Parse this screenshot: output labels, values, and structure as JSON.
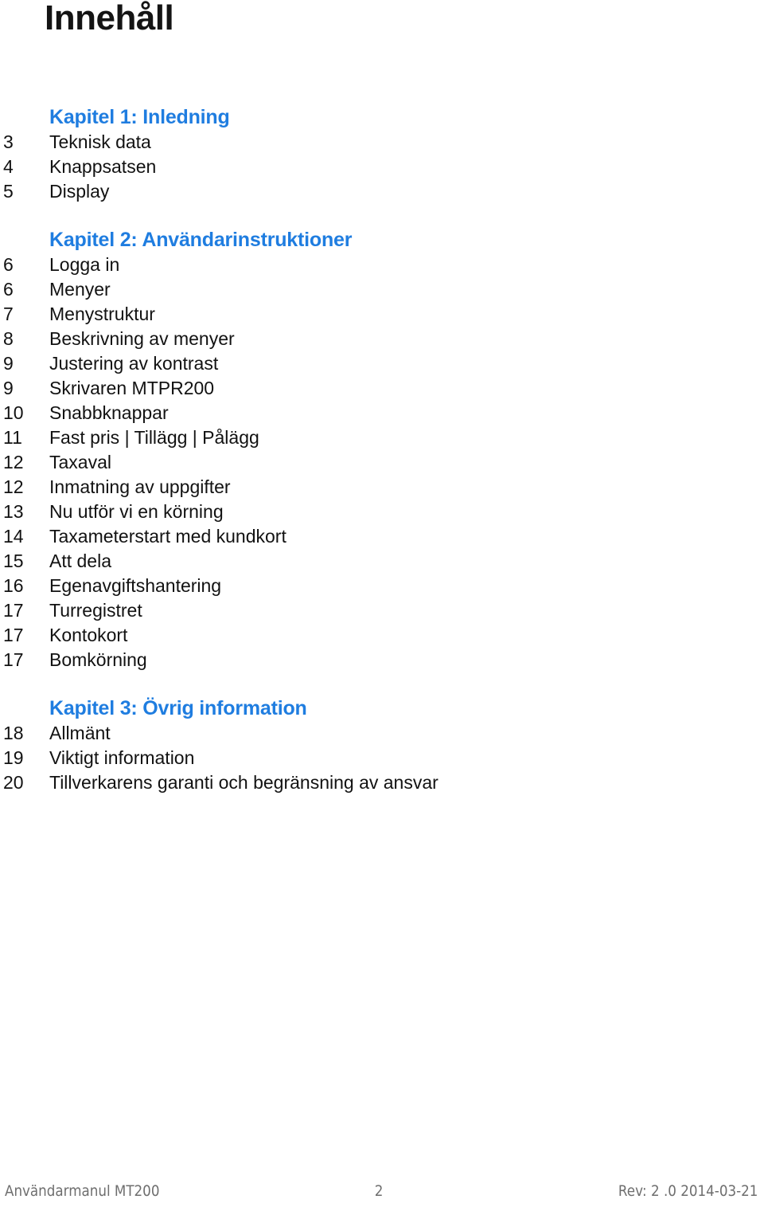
{
  "document": {
    "title": "Innehåll",
    "accent_color": "#1f7de0",
    "text_color": "#121212"
  },
  "toc": {
    "chapters": [
      {
        "heading": "Kapitel 1: Inledning",
        "entries": [
          {
            "page": "3",
            "label": "Teknisk data"
          },
          {
            "page": "4",
            "label": "Knappsatsen"
          },
          {
            "page": "5",
            "label": "Display"
          }
        ]
      },
      {
        "heading": "Kapitel 2: Användarinstruktioner",
        "entries": [
          {
            "page": "6",
            "label": "Logga in"
          },
          {
            "page": "6",
            "label": "Menyer"
          },
          {
            "page": "7",
            "label": "Menystruktur"
          },
          {
            "page": "8",
            "label": "Beskrivning av menyer"
          },
          {
            "page": "9",
            "label": "Justering av kontrast"
          },
          {
            "page": "9",
            "label": "Skrivaren MTPR200"
          },
          {
            "page": "10",
            "label": "Snabbknappar"
          },
          {
            "page": "11",
            "label": "Fast pris | Tillägg | Pålägg"
          },
          {
            "page": "12",
            "label": "Taxaval"
          },
          {
            "page": "12",
            "label": "Inmatning av uppgifter"
          },
          {
            "page": "13",
            "label": "Nu utför vi en körning"
          },
          {
            "page": "14",
            "label": "Taxameterstart med kundkort"
          },
          {
            "page": "15",
            "label": "Att dela"
          },
          {
            "page": "16",
            "label": "Egenavgiftshantering"
          },
          {
            "page": "17",
            "label": "Turregistret"
          },
          {
            "page": "17",
            "label": "Kontokort"
          },
          {
            "page": "17",
            "label": "Bomkörning"
          }
        ]
      },
      {
        "heading": "Kapitel 3: Övrig information",
        "entries": [
          {
            "page": "18",
            "label": "Allmänt"
          },
          {
            "page": "19",
            "label": "Viktigt information"
          },
          {
            "page": "20",
            "label": "Tillverkarens garanti och begränsning av ansvar"
          }
        ]
      }
    ]
  },
  "footer": {
    "left": "Användarmanul MT200",
    "center": "2",
    "right": "Rev: 2 .0  2014-03-21"
  }
}
